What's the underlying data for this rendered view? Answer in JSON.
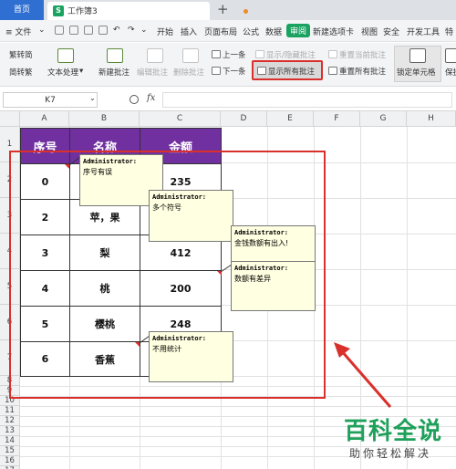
{
  "tabs": {
    "home": "首页",
    "doc_title": "工作簿3",
    "doc_icon": "S",
    "new_tab": "+"
  },
  "menu": {
    "file": "≡ 文件",
    "items": [
      "开始",
      "插入",
      "页面布局",
      "公式",
      "数据",
      "审阅",
      "新建选项卡",
      "视图",
      "安全",
      "开发工具",
      "特"
    ],
    "active": "审阅"
  },
  "ribbon": {
    "trad_simp": "繁转简",
    "simp_trad": "简转繁",
    "text_process": "文本处理",
    "new_comment": "新建批注",
    "edit_comment": "编辑批注",
    "delete_comment": "删除批注",
    "prev": "上一条",
    "next": "下一条",
    "show_hide": "显示/隐藏批注",
    "show_all": "显示所有批注",
    "reset_current": "重置当前批注",
    "reset_all": "重置所有批注",
    "lock_cell": "锁定单元格",
    "protect": "保护"
  },
  "formula_bar": {
    "cell_ref": "K7",
    "fx": "fx",
    "value": ""
  },
  "columns": [
    "A",
    "B",
    "C",
    "D",
    "E",
    "F",
    "G",
    "H"
  ],
  "rows": [
    "1",
    "2",
    "3",
    "4",
    "5",
    "6",
    "7",
    "8",
    "9",
    "10",
    "11",
    "12",
    "13",
    "14",
    "15",
    "16",
    "17"
  ],
  "table": {
    "headers": [
      "序号",
      "名称",
      "金额"
    ],
    "rows": [
      [
        "0",
        "",
        "235"
      ],
      [
        "2",
        "苹，果",
        ""
      ],
      [
        "3",
        "梨",
        "412"
      ],
      [
        "4",
        "桃",
        "200"
      ],
      [
        "5",
        "樱桃",
        "248"
      ],
      [
        "6",
        "香蕉",
        ""
      ]
    ]
  },
  "comments": [
    {
      "author": "Administrator:",
      "text": "序号有误"
    },
    {
      "author": "Administrator:",
      "text": "多个符号"
    },
    {
      "author": "Administrator:",
      "text": "金钱数额有出入!"
    },
    {
      "author": "Administrator:",
      "text": "数额有差异"
    },
    {
      "author": "Administrator:",
      "text": "不用统计"
    }
  ],
  "watermark": {
    "title": "百科全说",
    "subtitle": "助你轻松解决"
  },
  "colors": {
    "header_purple": "#7030a0",
    "accent_green": "#1aa260",
    "highlight_red": "#d9302c",
    "comment_bg": "#ffffe1"
  }
}
